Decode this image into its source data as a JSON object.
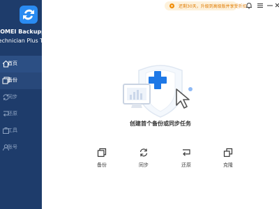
{
  "app": {
    "brand_name": "AOMEI Backupper",
    "edition": "Technician Plus Trial",
    "brand_color": "#1e3c6b",
    "accent": "#1e78e6"
  },
  "sidebar": {
    "items": [
      {
        "label": "首页",
        "icon": "home-icon",
        "state": "active"
      },
      {
        "label": "备份",
        "icon": "backup-icon",
        "state": "hover"
      },
      {
        "label": "同步",
        "icon": "sync-icon",
        "state": "normal"
      },
      {
        "label": "还原",
        "icon": "restore-icon",
        "state": "normal"
      },
      {
        "label": "工具",
        "icon": "tools-icon",
        "state": "normal"
      },
      {
        "label": "账号",
        "icon": "account-icon",
        "state": "normal"
      }
    ]
  },
  "header": {
    "promo_text": "还剩30天，升级到高级版并享受折扣",
    "promo_icon": "gift-icon",
    "buttons": [
      "notification-icon",
      "menu-icon",
      "minimize-icon",
      "close-icon"
    ]
  },
  "main": {
    "cta_text": "创建首个备份或同步任务",
    "actions": [
      {
        "label": "备份",
        "icon": "backup-icon"
      },
      {
        "label": "同步",
        "icon": "sync-icon"
      },
      {
        "label": "还原",
        "icon": "restore-icon"
      },
      {
        "label": "克隆",
        "icon": "clone-icon"
      }
    ]
  }
}
